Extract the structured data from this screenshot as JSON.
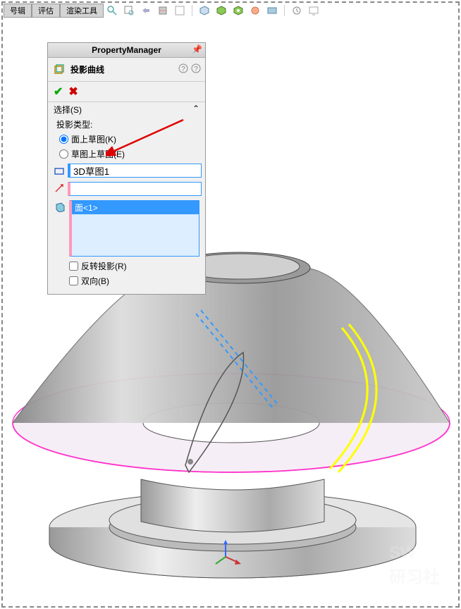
{
  "tabs": {
    "t1": "号辑",
    "t2": "评估",
    "t3": "渲染工具"
  },
  "panel": {
    "title": "PropertyManager",
    "feature": "投影曲线",
    "section_title": "选择(S)",
    "proj_type_label": "投影类型:",
    "radio1": "面上草图(K)",
    "radio2": "草图上草图(E)",
    "sketch_value": "3D草图1",
    "face_value": "面<1>",
    "chk1": "反转投影(R)",
    "chk2": "双向(B)"
  }
}
